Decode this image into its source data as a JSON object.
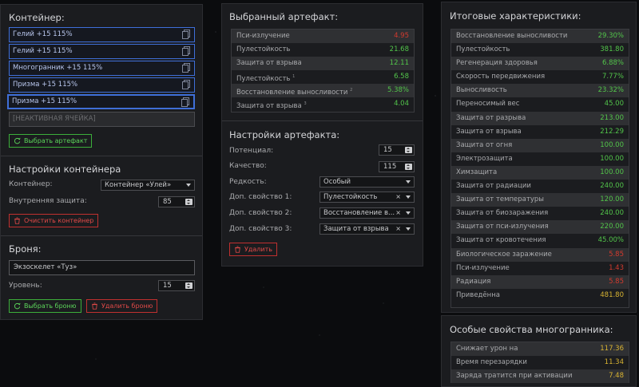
{
  "container": {
    "title": "Контейнер:",
    "slots": [
      {
        "label": "Гелий +15 115%"
      },
      {
        "label": "Гелий +15 115%"
      },
      {
        "label": "Многогранник +15 115%"
      },
      {
        "label": "Призма +15 115%"
      },
      {
        "label": "Призма +15 115%"
      }
    ],
    "empty_slot": "[НЕАКТИВНАЯ ЯЧЕЙКА]",
    "choose_artifact": "Выбрать артефакт",
    "settings_title": "Настройки контейнера",
    "container_label": "Контейнер:",
    "container_value": "Контейнер «Улей»",
    "protection_label": "Внутренняя защита:",
    "protection_value": "85",
    "clear_button": "Очистить контейнер"
  },
  "armor": {
    "title": "Броня:",
    "name_value": "Экзоскелет «Туз»",
    "level_label": "Уровень:",
    "level_value": "15",
    "choose_button": "Выбрать броню",
    "delete_button": "Удалить броню"
  },
  "artifact": {
    "title": "Выбранный артефакт:",
    "stats": [
      {
        "name": "Пси-излучение",
        "value": "4.95",
        "color": "red",
        "note": ""
      },
      {
        "name": "Пулестойкость",
        "value": "21.68",
        "color": "green",
        "note": ""
      },
      {
        "name": "Защита от взрыва",
        "value": "12.11",
        "color": "green",
        "note": ""
      },
      {
        "name": "Пулестойкость",
        "value": "6.58",
        "color": "green",
        "note": "1"
      },
      {
        "name": "Восстановление выносливости",
        "value": "5.38%",
        "color": "green",
        "note": "2"
      },
      {
        "name": "Защита от взрыва",
        "value": "4.04",
        "color": "green",
        "note": "3"
      }
    ],
    "settings_title": "Настройки артефакта:",
    "potential_label": "Потенциал:",
    "potential_value": "15",
    "quality_label": "Качество:",
    "quality_value": "115",
    "rarity_label": "Редкость:",
    "rarity_value": "Особый",
    "extra1_label": "Доп. свойство 1:",
    "extra1_value": "Пулестойкость",
    "extra2_label": "Доп. свойство 2:",
    "extra2_value": "Восстановление в...",
    "extra3_label": "Доп. свойство 3:",
    "extra3_value": "Защита от взрыва",
    "delete_button": "Удалить"
  },
  "totals": {
    "title": "Итоговые характеристики:",
    "stats": [
      {
        "name": "Восстановление выносливости",
        "value": "29.30%",
        "color": "green"
      },
      {
        "name": "Пулестойкость",
        "value": "381.80",
        "color": "green"
      },
      {
        "name": "Регенерация здоровья",
        "value": "6.88%",
        "color": "green"
      },
      {
        "name": "Скорость передвижения",
        "value": "7.77%",
        "color": "green"
      },
      {
        "name": "Выносливость",
        "value": "23.32%",
        "color": "green"
      },
      {
        "name": "Переносимый вес",
        "value": "45.00",
        "color": "green"
      },
      {
        "name": "Защита от разрыва",
        "value": "213.00",
        "color": "green"
      },
      {
        "name": "Защита от взрыва",
        "value": "212.29",
        "color": "green"
      },
      {
        "name": "Защита от огня",
        "value": "100.00",
        "color": "green"
      },
      {
        "name": "Электрозащита",
        "value": "100.00",
        "color": "green"
      },
      {
        "name": "Химзащита",
        "value": "100.00",
        "color": "green"
      },
      {
        "name": "Защита от радиации",
        "value": "240.00",
        "color": "green"
      },
      {
        "name": "Защита от температуры",
        "value": "120.00",
        "color": "green"
      },
      {
        "name": "Защита от биозаражения",
        "value": "240.00",
        "color": "green"
      },
      {
        "name": "Защита от пси-излучения",
        "value": "220.00",
        "color": "green"
      },
      {
        "name": "Защита от кровотечения",
        "value": "45.00%",
        "color": "green"
      },
      {
        "name": "Биологическое заражение",
        "value": "5.85",
        "color": "red"
      },
      {
        "name": "Пси-излучение",
        "value": "1.43",
        "color": "red"
      },
      {
        "name": "Радиация",
        "value": "5.85",
        "color": "red"
      },
      {
        "name": "Приведённа",
        "value": "481.80",
        "color": "yellow"
      }
    ]
  },
  "special": {
    "title": "Особые свойства многогранника:",
    "stats": [
      {
        "name": "Снижает урон на",
        "value": "117.36",
        "color": "yellow"
      },
      {
        "name": "Время перезарядки",
        "value": "11.34",
        "color": "yellow"
      },
      {
        "name": "Заряда тратится при активации",
        "value": "7.48",
        "color": "yellow"
      }
    ]
  }
}
